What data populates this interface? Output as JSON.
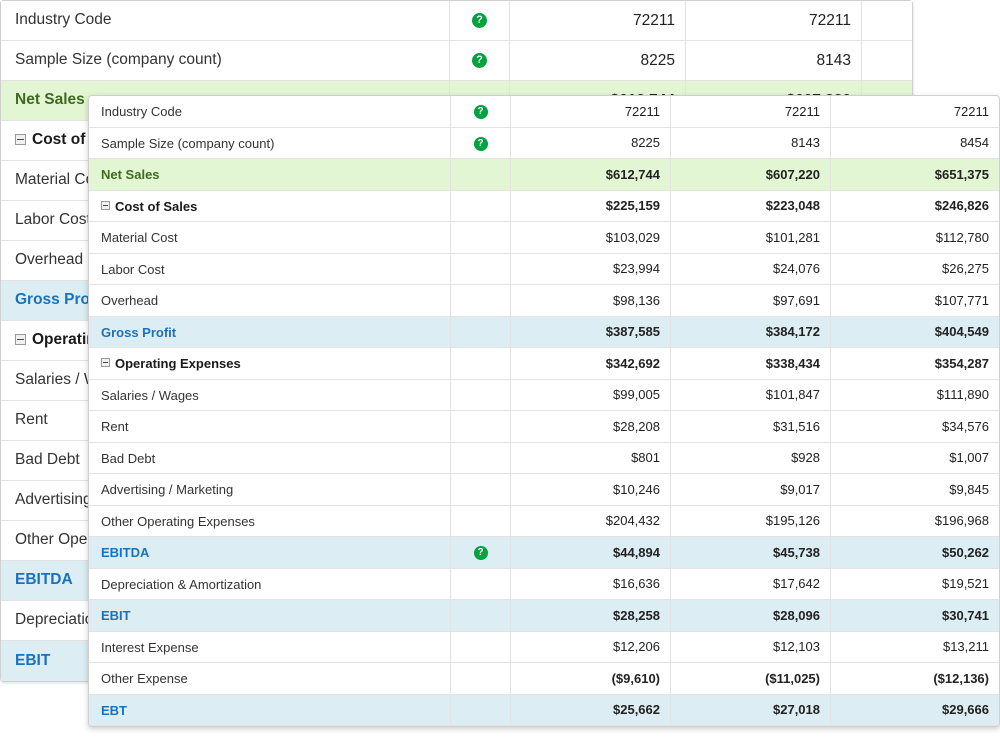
{
  "icons": {
    "help": "?",
    "collapse": "collapse-box-icon"
  },
  "colors": {
    "green_row": "#e3f6d4",
    "blue_row": "#dcedf4",
    "green_text": "#3f6b1f",
    "blue_text": "#1b72b8",
    "red_text": "#ff0000",
    "help_icon": "#00a33e",
    "border": "#e3e3e3"
  },
  "background_table": {
    "rows": [
      {
        "label": "Industry Code",
        "help": true,
        "style": "white",
        "text": "normal",
        "indent": 0,
        "collapse": false,
        "v1": "72211",
        "v2": "72211",
        "v3": ""
      },
      {
        "label": "Sample Size (company count)",
        "help": true,
        "style": "white",
        "text": "normal",
        "indent": 0,
        "collapse": false,
        "v1": "8225",
        "v2": "8143",
        "v3": ""
      },
      {
        "label": "Net Sales",
        "help": false,
        "style": "green",
        "text": "green",
        "indent": 0,
        "collapse": false,
        "v1": "$612,744",
        "v2": "$607,220",
        "v3": ""
      },
      {
        "label": "Cost of Sales",
        "help": false,
        "style": "white",
        "text": "bold",
        "indent": 0,
        "collapse": true,
        "v1": "$225,159",
        "v2": "$223,048",
        "v3": ""
      },
      {
        "label": "Material Cost",
        "help": false,
        "style": "white",
        "text": "normal",
        "indent": 1,
        "collapse": false,
        "v1": "$103,029",
        "v2": "$101,281",
        "v3": ""
      },
      {
        "label": "Labor Cost",
        "help": false,
        "style": "white",
        "text": "normal",
        "indent": 1,
        "collapse": false,
        "v1": "$23,994",
        "v2": "$24,076",
        "v3": ""
      },
      {
        "label": "Overhead",
        "help": false,
        "style": "white",
        "text": "normal",
        "indent": 1,
        "collapse": false,
        "v1": "$98,136",
        "v2": "$97,691",
        "v3": ""
      },
      {
        "label": "Gross Profit",
        "help": false,
        "style": "blue",
        "text": "blue",
        "indent": 0,
        "collapse": false,
        "v1": "$387,585",
        "v2": "$384,172",
        "v3": ""
      },
      {
        "label": "Operating Expenses",
        "help": false,
        "style": "white",
        "text": "bold",
        "indent": 0,
        "collapse": true,
        "v1": "$342,692",
        "v2": "$338,434",
        "v3": ""
      },
      {
        "label": "Salaries / Wages",
        "help": false,
        "style": "white",
        "text": "normal",
        "indent": 1,
        "collapse": false,
        "v1": "$99,005",
        "v2": "$101,847",
        "v3": ""
      },
      {
        "label": "Rent",
        "help": false,
        "style": "white",
        "text": "normal",
        "indent": 1,
        "collapse": false,
        "v1": "$28,208",
        "v2": "$31,516",
        "v3": ""
      },
      {
        "label": "Bad Debt",
        "help": false,
        "style": "white",
        "text": "normal",
        "indent": 1,
        "collapse": false,
        "v1": "$801",
        "v2": "$928",
        "v3": ""
      },
      {
        "label": "Advertising / Marketing",
        "help": false,
        "style": "white",
        "text": "normal",
        "indent": 1,
        "collapse": false,
        "v1": "$10,246",
        "v2": "$9,017",
        "v3": ""
      },
      {
        "label": "Other Operating Expenses",
        "help": false,
        "style": "white",
        "text": "normal",
        "indent": 1,
        "collapse": false,
        "v1": "$204,432",
        "v2": "$195,126",
        "v3": ""
      },
      {
        "label": "EBITDA",
        "help": true,
        "style": "blue",
        "text": "blue",
        "indent": 0,
        "collapse": false,
        "v1": "$44,894",
        "v2": "$45,738",
        "v3": ""
      },
      {
        "label": "Depreciation & Amortization",
        "help": false,
        "style": "white",
        "text": "normal",
        "indent": 0,
        "collapse": false,
        "v1": "$16,636",
        "v2": "$17,642",
        "v3": ""
      },
      {
        "label": "EBIT",
        "help": false,
        "style": "blue",
        "text": "blue",
        "indent": 0,
        "collapse": false,
        "v1": "$28,258",
        "v2": "$28,096",
        "v3": ""
      }
    ]
  },
  "foreground_panel": {
    "rows": [
      {
        "label": "Industry Code",
        "help": true,
        "style": "white",
        "text": "normal",
        "indent": 0,
        "collapse": false,
        "v1": "72211",
        "v2": "72211",
        "v3": "72211",
        "valstyle": "normal"
      },
      {
        "label": "Sample Size (company count)",
        "help": true,
        "style": "white",
        "text": "normal",
        "indent": 0,
        "collapse": false,
        "v1": "8225",
        "v2": "8143",
        "v3": "8454",
        "valstyle": "normal"
      },
      {
        "label": "Net Sales",
        "help": false,
        "style": "green",
        "text": "green",
        "indent": 0,
        "collapse": false,
        "v1": "$612,744",
        "v2": "$607,220",
        "v3": "$651,375",
        "valstyle": "green"
      },
      {
        "label": "Cost of Sales",
        "help": false,
        "style": "white",
        "text": "bold",
        "indent": 0,
        "collapse": true,
        "v1": "$225,159",
        "v2": "$223,048",
        "v3": "$246,826",
        "valstyle": "bold"
      },
      {
        "label": "Material Cost",
        "help": false,
        "style": "white",
        "text": "normal",
        "indent": 1,
        "collapse": false,
        "v1": "$103,029",
        "v2": "$101,281",
        "v3": "$112,780",
        "valstyle": "normal"
      },
      {
        "label": "Labor Cost",
        "help": false,
        "style": "white",
        "text": "normal",
        "indent": 1,
        "collapse": false,
        "v1": "$23,994",
        "v2": "$24,076",
        "v3": "$26,275",
        "valstyle": "normal"
      },
      {
        "label": "Overhead",
        "help": false,
        "style": "white",
        "text": "normal",
        "indent": 1,
        "collapse": false,
        "v1": "$98,136",
        "v2": "$97,691",
        "v3": "$107,771",
        "valstyle": "normal"
      },
      {
        "label": "Gross Profit",
        "help": false,
        "style": "blue",
        "text": "blue",
        "indent": 0,
        "collapse": false,
        "v1": "$387,585",
        "v2": "$384,172",
        "v3": "$404,549",
        "valstyle": "blue"
      },
      {
        "label": "Operating Expenses",
        "help": false,
        "style": "white",
        "text": "bold",
        "indent": 0,
        "collapse": true,
        "v1": "$342,692",
        "v2": "$338,434",
        "v3": "$354,287",
        "valstyle": "bold"
      },
      {
        "label": "Salaries / Wages",
        "help": false,
        "style": "white",
        "text": "normal",
        "indent": 1,
        "collapse": false,
        "v1": "$99,005",
        "v2": "$101,847",
        "v3": "$111,890",
        "valstyle": "normal"
      },
      {
        "label": "Rent",
        "help": false,
        "style": "white",
        "text": "normal",
        "indent": 1,
        "collapse": false,
        "v1": "$28,208",
        "v2": "$31,516",
        "v3": "$34,576",
        "valstyle": "normal"
      },
      {
        "label": "Bad Debt",
        "help": false,
        "style": "white",
        "text": "normal",
        "indent": 1,
        "collapse": false,
        "v1": "$801",
        "v2": "$928",
        "v3": "$1,007",
        "valstyle": "normal"
      },
      {
        "label": "Advertising / Marketing",
        "help": false,
        "style": "white",
        "text": "normal",
        "indent": 1,
        "collapse": false,
        "v1": "$10,246",
        "v2": "$9,017",
        "v3": "$9,845",
        "valstyle": "normal"
      },
      {
        "label": "Other Operating Expenses",
        "help": false,
        "style": "white",
        "text": "normal",
        "indent": 1,
        "collapse": false,
        "v1": "$204,432",
        "v2": "$195,126",
        "v3": "$196,968",
        "valstyle": "normal"
      },
      {
        "label": "EBITDA",
        "help": true,
        "style": "blue",
        "text": "blue",
        "indent": 0,
        "collapse": false,
        "v1": "$44,894",
        "v2": "$45,738",
        "v3": "$50,262",
        "valstyle": "blue"
      },
      {
        "label": "Depreciation & Amortization",
        "help": false,
        "style": "white",
        "text": "normal",
        "indent": 0,
        "collapse": false,
        "v1": "$16,636",
        "v2": "$17,642",
        "v3": "$19,521",
        "valstyle": "normal"
      },
      {
        "label": "EBIT",
        "help": false,
        "style": "blue",
        "text": "blue",
        "indent": 0,
        "collapse": false,
        "v1": "$28,258",
        "v2": "$28,096",
        "v3": "$30,741",
        "valstyle": "blue"
      },
      {
        "label": "Interest Expense",
        "help": false,
        "style": "white",
        "text": "normal",
        "indent": 0,
        "collapse": false,
        "v1": "$12,206",
        "v2": "$12,103",
        "v3": "$13,211",
        "valstyle": "normal"
      },
      {
        "label": "Other Expense",
        "help": false,
        "style": "white",
        "text": "normal",
        "indent": 0,
        "collapse": false,
        "v1": "($9,610)",
        "v2": "($11,025)",
        "v3": "($12,136)",
        "valstyle": "red"
      },
      {
        "label": "EBT",
        "help": false,
        "style": "blue",
        "text": "blue",
        "indent": 0,
        "collapse": false,
        "v1": "$25,662",
        "v2": "$27,018",
        "v3": "$29,666",
        "valstyle": "blue"
      }
    ]
  }
}
